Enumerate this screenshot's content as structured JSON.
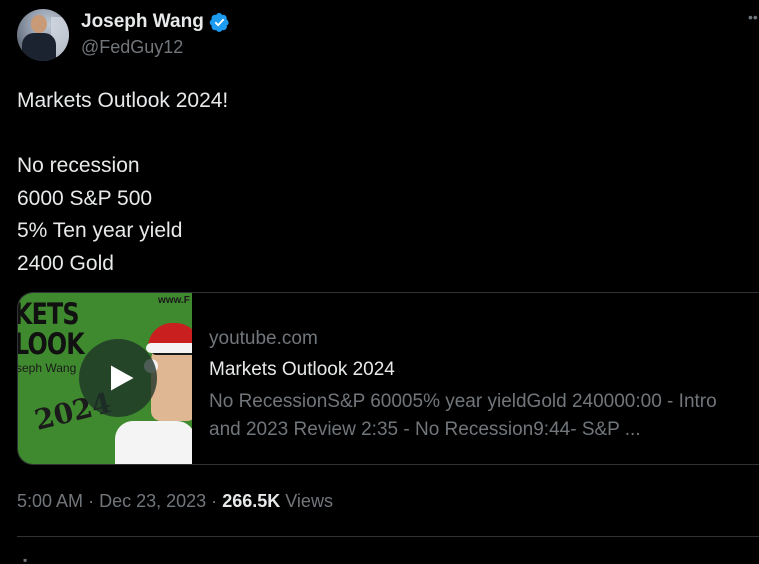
{
  "author": {
    "display_name": "Joseph Wang",
    "handle": "@FedGuy12",
    "verified_icon": "verified-badge-icon",
    "accent": "#1d9bf0"
  },
  "tweet": {
    "lines": [
      "Markets Outlook 2024!",
      "",
      "No recession",
      "6000 S&P 500",
      "5% Ten year yield",
      "2400 Gold"
    ]
  },
  "card": {
    "thumbnail": {
      "title_line1": "KETS",
      "title_line2": "LOOK",
      "name": "seph Wang",
      "url": "www.F",
      "year": "2024"
    },
    "play_icon": "play-icon",
    "domain": "youtube.com",
    "title": "Markets Outlook 2024",
    "description": "No RecessionS&P 60005% year yieldGold 240000:00 - Intro and 2023 Review 2:35 - No Recession9:44- S&P ..."
  },
  "meta": {
    "time": "5:00 AM",
    "separator": "·",
    "date": "Dec 23, 2023",
    "views_count": "266.5K",
    "views_label": "Views"
  }
}
